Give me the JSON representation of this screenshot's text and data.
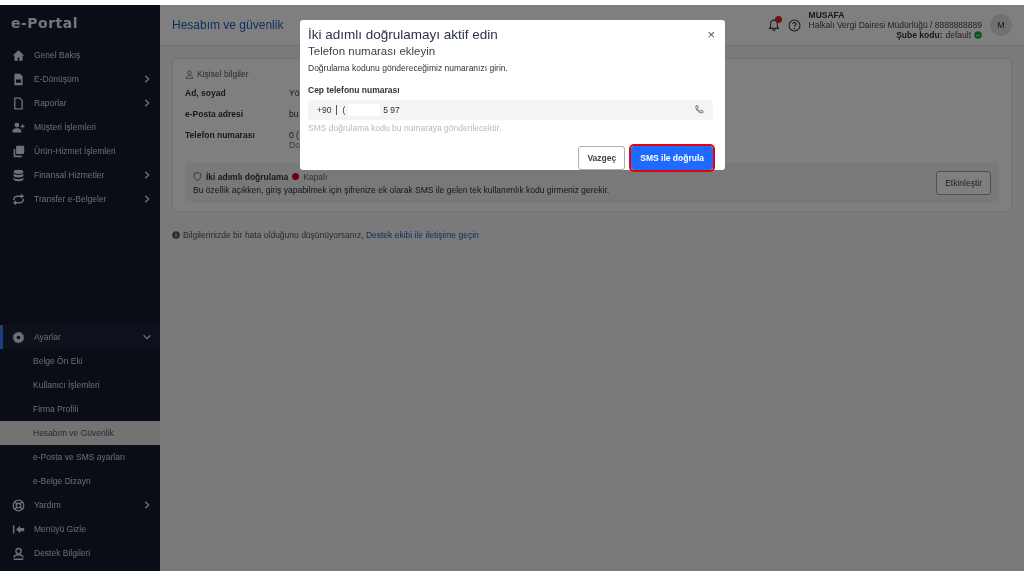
{
  "sidebar": {
    "logo": "e-Portal",
    "items": [
      {
        "label": "Genel Bakış",
        "has_submenu": false
      },
      {
        "label": "E-Dönüşüm",
        "has_submenu": true
      },
      {
        "label": "Raporlar",
        "has_submenu": true
      },
      {
        "label": "Müşteri İşlemleri",
        "has_submenu": false
      },
      {
        "label": "Ürün-Hizmet İşlemleri",
        "has_submenu": false
      },
      {
        "label": "Finansal Hizmetler",
        "has_submenu": true
      },
      {
        "label": "Transfer e-Belgeler",
        "has_submenu": true
      }
    ],
    "settings": {
      "label": "Ayarlar",
      "expanded": true,
      "children": [
        {
          "label": "Belge Ön Eki",
          "selected": false
        },
        {
          "label": "Kullanıcı İşlemleri",
          "selected": false
        },
        {
          "label": "Firma Profili",
          "selected": false
        },
        {
          "label": "Hesabım ve Güvenlik",
          "selected": true
        },
        {
          "label": "e-Posta ve SMS ayarları",
          "selected": false
        },
        {
          "label": "e-Belge Dizayn",
          "selected": false
        }
      ]
    },
    "bottom_items": [
      {
        "label": "Yardım",
        "has_submenu": true
      },
      {
        "label": "Menüyü Gizle",
        "has_submenu": false
      },
      {
        "label": "Destek Bilgileri",
        "has_submenu": false
      }
    ]
  },
  "header": {
    "title": "Hesabım ve güvenlik",
    "user_name": "MUSAFA",
    "office": "Halkalı Vergi Dairesi Müdürlüğü / 8888888889",
    "branch_label": "Şube kodu:",
    "branch_value": "default",
    "branch_verified": true,
    "avatar": "M"
  },
  "card": {
    "section_title": "Kişisel bilgiler",
    "rows": [
      {
        "label": "Ad, soyad",
        "value": "Yö"
      },
      {
        "label": "e-Posta adresi",
        "value": "bu"
      },
      {
        "label": "Telefon numarası",
        "value": "0 (",
        "note": "Do"
      }
    ],
    "two_factor": {
      "title": "İki adımlı doğrulama",
      "enabled": false,
      "status": "Kapalı",
      "description": "Bu özellik açıkken, giriş yapabilmek için şifrenize ek olarak SMS ile gelen tek kullanımlık kodu girmeniz gerekir.",
      "button": "Etkinleştir"
    }
  },
  "footer_note": {
    "text": "Bilgilerinizde bir hata olduğunu düşünüyorsanız, ",
    "link": "Destek ekibi ile iletişime geçin"
  },
  "modal": {
    "title": "İki adımlı doğrulamayı aktif edin",
    "close": "×",
    "subtitle": "Telefon numarası ekleyin",
    "description": "Doğrulama kodunu göndereceğimiz numaranızı girin.",
    "field_label": "Cep telefonu numarası",
    "prefix": "+90",
    "value_start": "(",
    "value_end": "5 97",
    "hint": "SMS doğrulama kodu bu numaraya gönderilecektir.",
    "buttons": [
      {
        "label": "Vazgeç",
        "kind": "secondary",
        "highlighted": false
      },
      {
        "label": "SMS ile doğrula",
        "kind": "primary",
        "highlighted": true
      }
    ]
  }
}
